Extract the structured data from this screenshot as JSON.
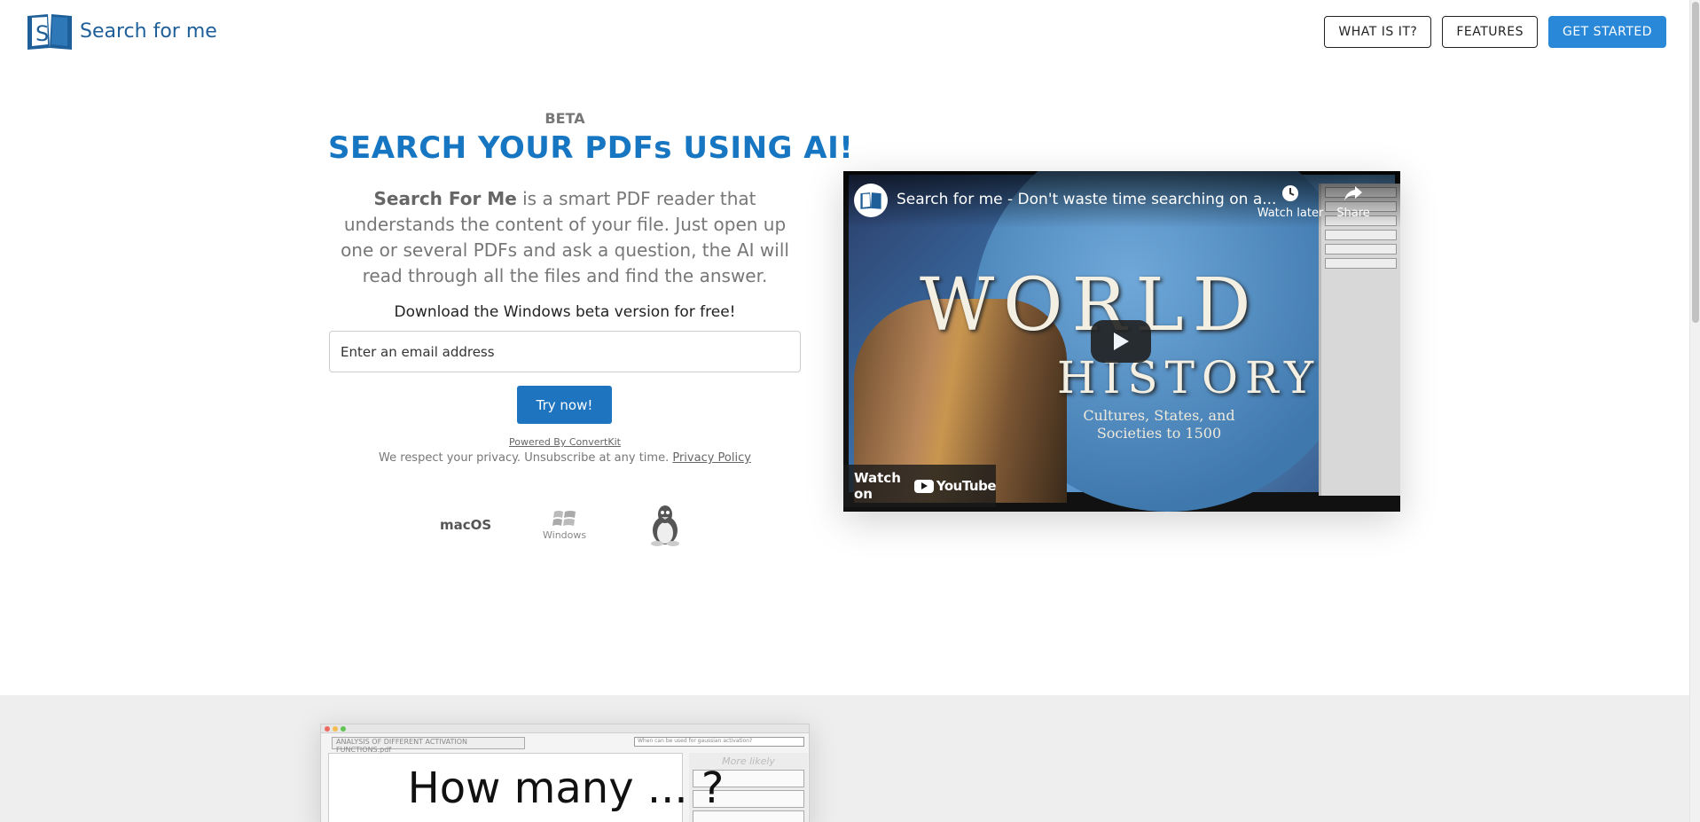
{
  "header": {
    "logo_text": "Search for me",
    "nav": [
      {
        "label": "WHAT IS IT?"
      },
      {
        "label": "FEATURES"
      },
      {
        "label": "GET STARTED"
      }
    ]
  },
  "hero": {
    "beta": "BETA",
    "headline": "SEARCH YOUR PDFs USING AI!",
    "intro_bold": "Search For Me",
    "intro_rest": " is a smart PDF reader that understands the content of your file. Just open up one or several PDFs and ask a question, the AI will read through all the files and find the answer.",
    "download_text": "Download the Windows beta version for free!",
    "email_placeholder": "Enter an email address",
    "try_button": "Try now!",
    "powered_by": "Powered By ConvertKit",
    "privacy_text": "We respect your privacy. Unsubscribe at any time.",
    "privacy_link": "Privacy Policy",
    "os": {
      "mac": "macOS",
      "windows": "Windows"
    }
  },
  "video": {
    "title": "Search for me - Don't waste time searching on a...",
    "watch_later": "Watch later",
    "share": "Share",
    "watch_on": "Watch on",
    "youtube": "YouTube",
    "thumb_world": "WORLD",
    "thumb_history": "HISTORY",
    "thumb_subtitle": "Cultures, States, and Societies to 1500"
  },
  "preview": {
    "tab": "ANALYSIS OF DIFFERENT ACTIVATION FUNCTIONS.pdf",
    "search": "When can be used for gaussian activation?",
    "more_likely": "More likely",
    "overlay": "How many ... ?"
  }
}
